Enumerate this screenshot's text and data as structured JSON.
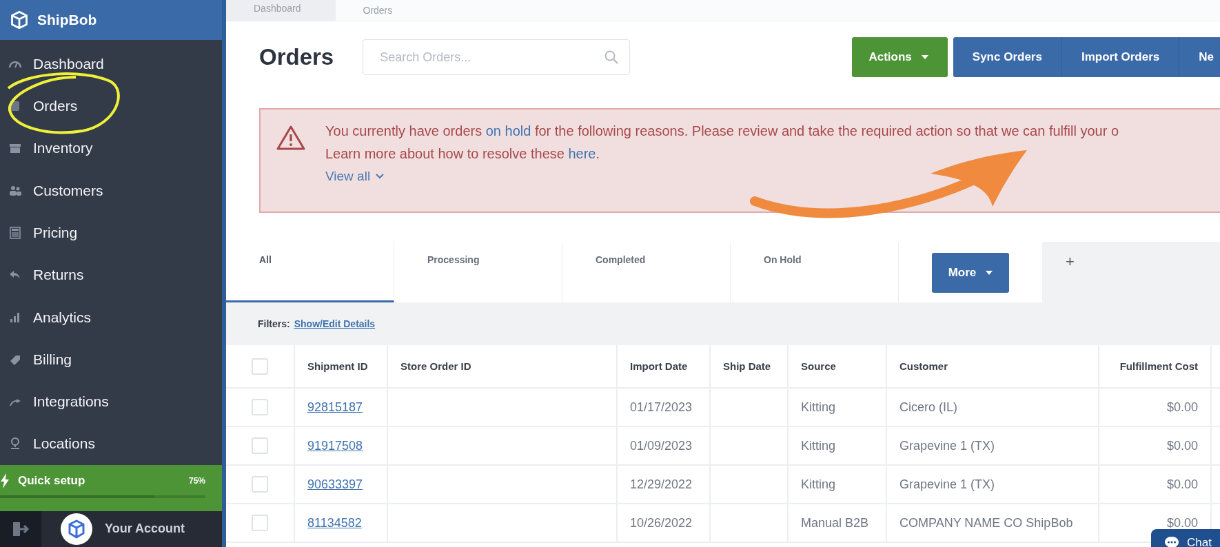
{
  "brand": {
    "name": "ShipBob"
  },
  "sidebar": {
    "items": [
      {
        "label": "Dashboard"
      },
      {
        "label": "Orders"
      },
      {
        "label": "Inventory"
      },
      {
        "label": "Customers"
      },
      {
        "label": "Pricing"
      },
      {
        "label": "Returns"
      },
      {
        "label": "Analytics"
      },
      {
        "label": "Billing"
      },
      {
        "label": "Integrations"
      },
      {
        "label": "Locations"
      }
    ],
    "quick_setup": {
      "label": "Quick setup",
      "percent": "75%",
      "level": 0.75
    },
    "account": {
      "label": "Your Account"
    }
  },
  "breadcrumb": [
    "Dashboard",
    "Orders"
  ],
  "page_title": "Orders",
  "search": {
    "placeholder": "Search Orders..."
  },
  "actions_button": "Actions",
  "button_group": [
    "Sync Orders",
    "Import Orders",
    "Ne"
  ],
  "alert": {
    "line1_before": "You currently have orders ",
    "link1": "on hold",
    "line1_after": " for the following reasons. Please review and take the required action so that we can fulfill your o",
    "line2_before": "Learn more about how to resolve these ",
    "link2": "here",
    "line2_after": ".",
    "toggle": "View all"
  },
  "tabs": [
    {
      "label": "All",
      "selected": true
    },
    {
      "label": "Processing",
      "selected": false
    },
    {
      "label": "Completed",
      "selected": false
    },
    {
      "label": "On Hold",
      "selected": false
    }
  ],
  "more_button": "More",
  "add_tab": "+",
  "filters": {
    "label": "Filters:",
    "link": "Show/Edit Details"
  },
  "table": {
    "select_all_checked": false,
    "columns": [
      "Shipment ID",
      "Store Order ID",
      "Import Date",
      "Ship Date",
      "Source",
      "Customer",
      "Fulfillment Cost"
    ],
    "rows": [
      {
        "checked": false,
        "cells": [
          "92815187",
          "",
          "01/17/2023",
          "",
          "Kitting",
          "Cicero (IL)",
          "$0.00"
        ]
      },
      {
        "checked": false,
        "cells": [
          "91917508",
          "",
          "01/09/2023",
          "",
          "Kitting",
          "Grapevine 1 (TX)",
          "$0.00"
        ]
      },
      {
        "checked": false,
        "cells": [
          "90633397",
          "",
          "12/29/2022",
          "",
          "Kitting",
          "Grapevine 1 (TX)",
          "$0.00"
        ]
      },
      {
        "checked": false,
        "cells": [
          "81134582",
          "",
          "10/26/2022",
          "",
          "Manual B2B",
          "COMPANY NAME CO ShipBob",
          "$0.00"
        ]
      }
    ]
  },
  "chat_button": "Chat"
}
